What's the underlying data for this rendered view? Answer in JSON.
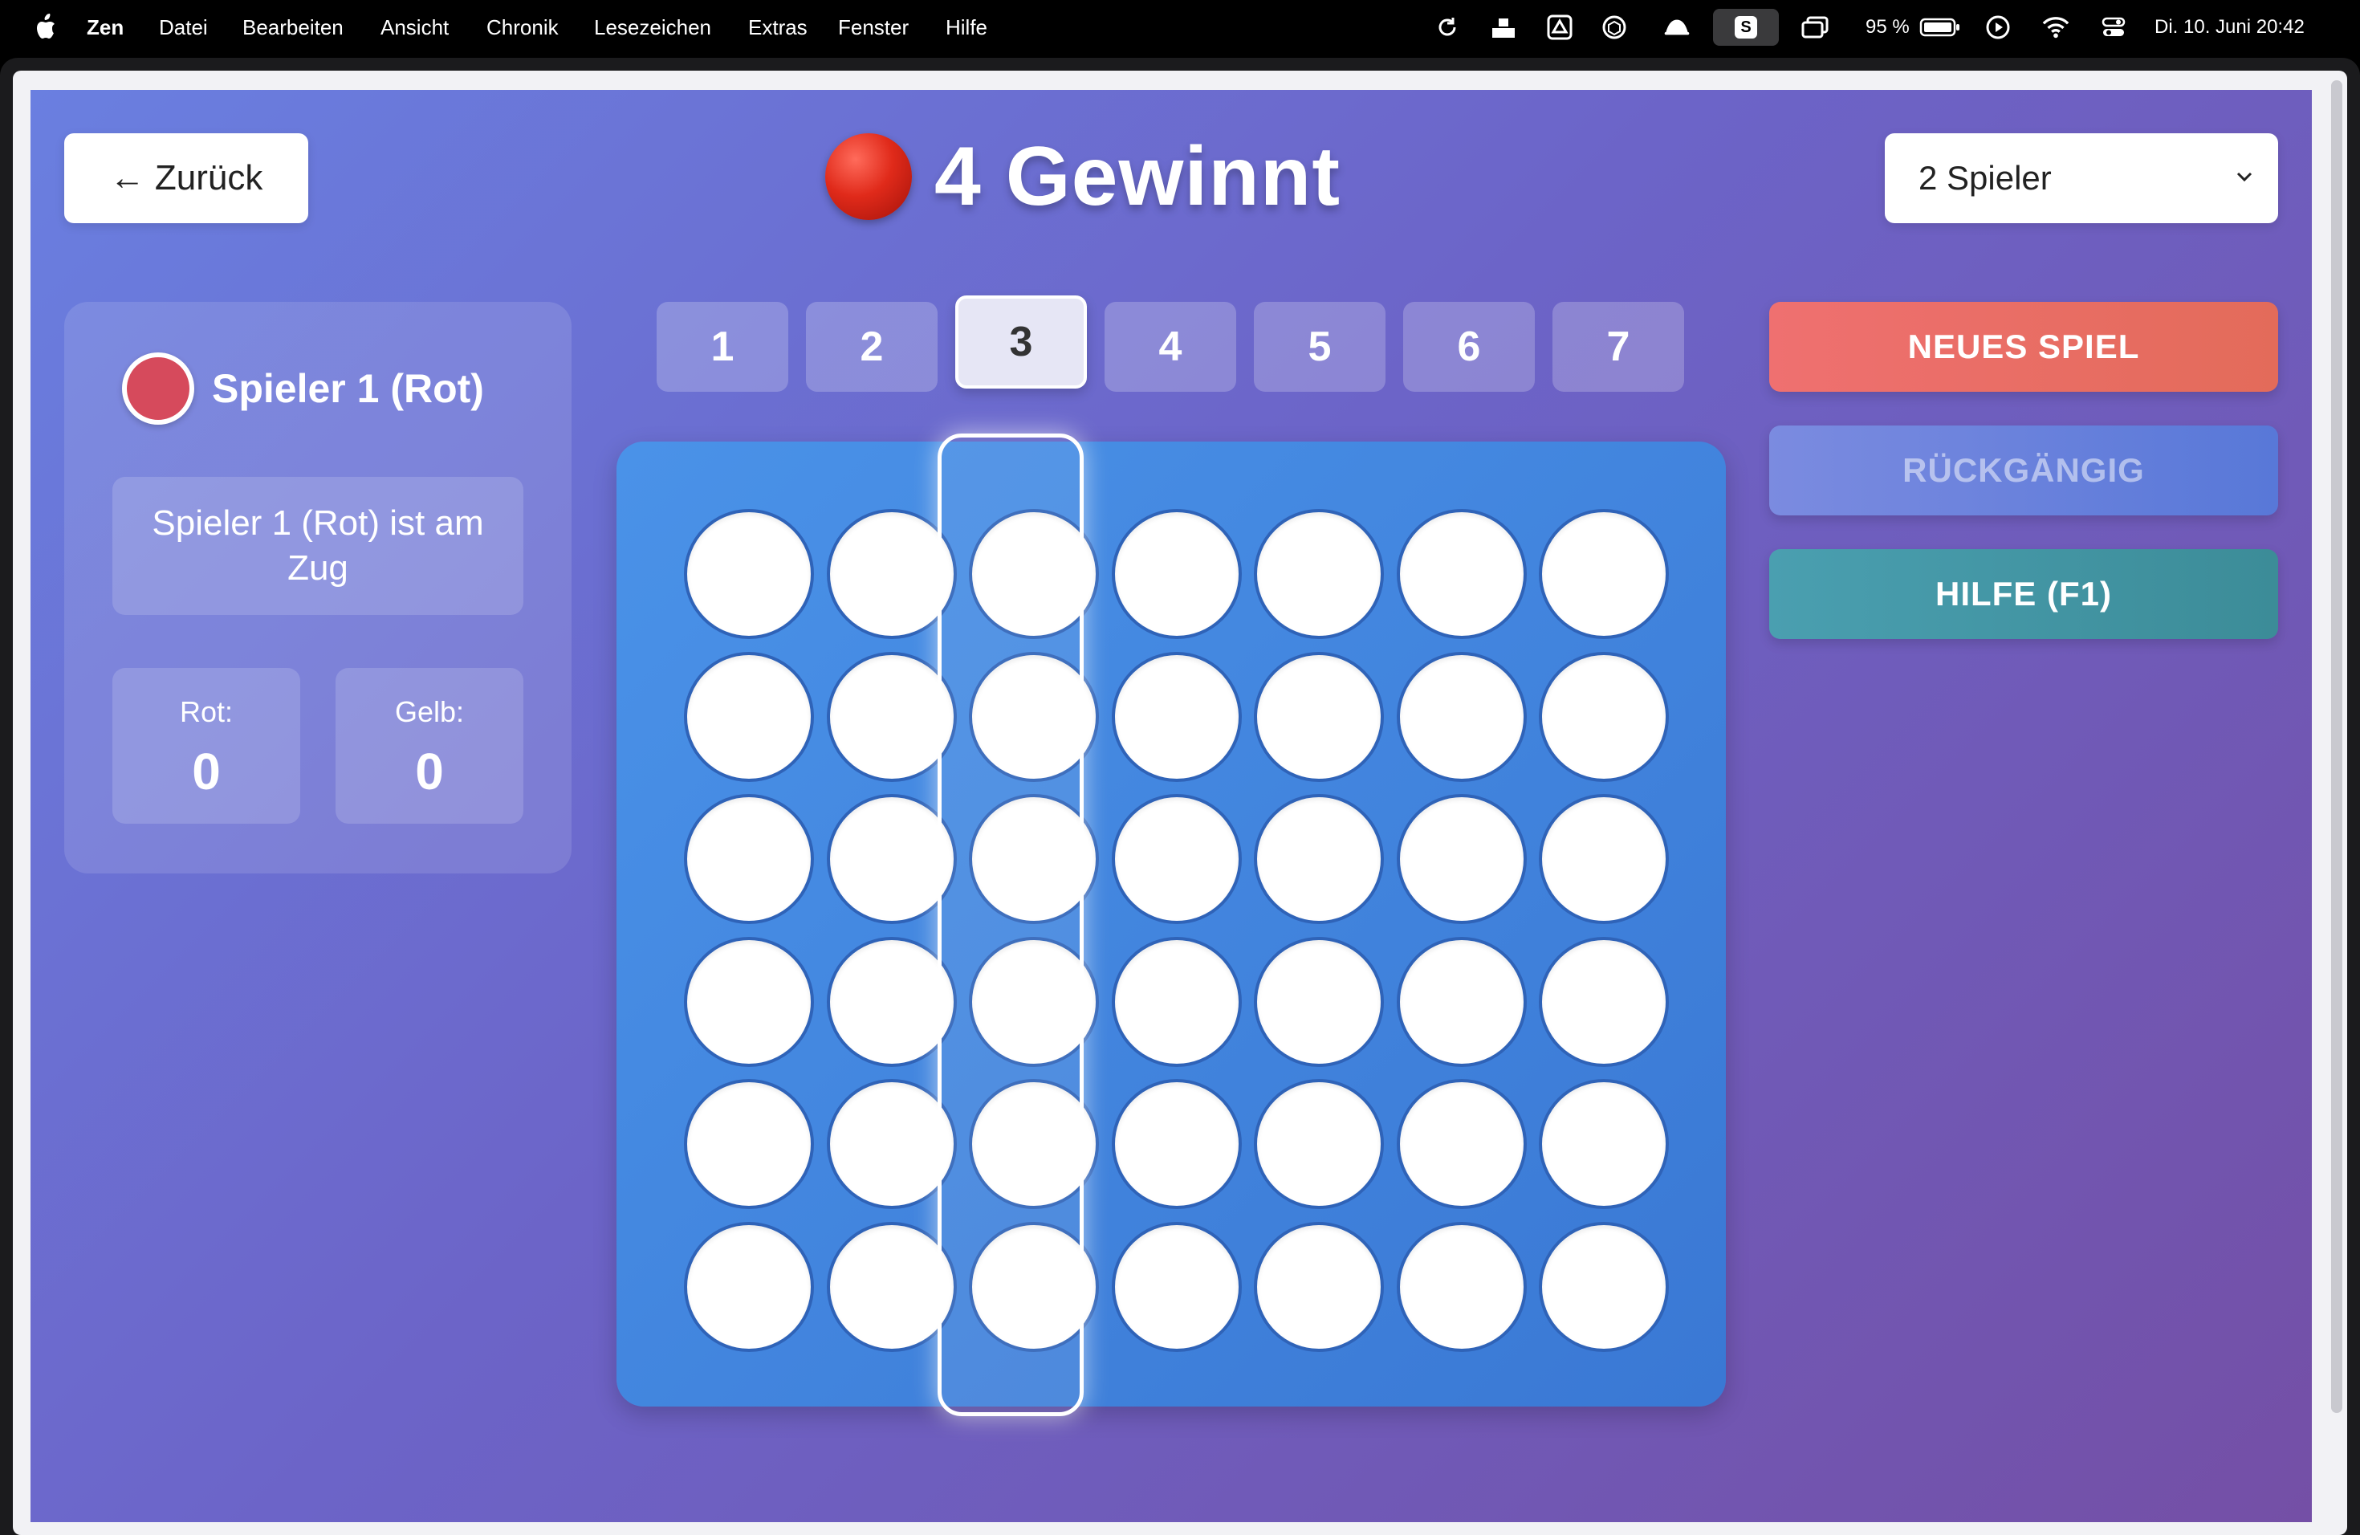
{
  "menubar": {
    "app_name": "Zen",
    "menus": [
      "Datei",
      "Bearbeiten",
      "Ansicht",
      "Chronik",
      "Lesezeichen",
      "Extras",
      "Fenster",
      "Hilfe"
    ],
    "battery": "95 %",
    "datetime": "Di. 10. Juni  20:42",
    "s_badge": "S"
  },
  "header": {
    "back_label": "← Zurück",
    "title": "4 Gewinnt",
    "mode_selected": "2 Spieler"
  },
  "player_panel": {
    "current_player": "Spieler 1 (Rot)",
    "turn_text": "Spieler 1 (Rot) ist am Zug",
    "scores": [
      {
        "label": "Rot:",
        "value": "0"
      },
      {
        "label": "Gelb:",
        "value": "0"
      }
    ]
  },
  "columns": [
    "1",
    "2",
    "3",
    "4",
    "5",
    "6",
    "7"
  ],
  "selected_column": "3",
  "board": {
    "rows": 6,
    "cols": 7,
    "cells": [
      [
        "",
        "",
        "",
        "",
        "",
        "",
        ""
      ],
      [
        "",
        "",
        "",
        "",
        "",
        "",
        ""
      ],
      [
        "",
        "",
        "",
        "",
        "",
        "",
        ""
      ],
      [
        "",
        "",
        "",
        "",
        "",
        "",
        ""
      ],
      [
        "",
        "",
        "",
        "",
        "",
        "",
        ""
      ],
      [
        "",
        "",
        "",
        "",
        "",
        "",
        ""
      ]
    ]
  },
  "actions": {
    "new_game": "NEUES SPIEL",
    "undo": "RÜCKGÄNGIG",
    "help": "HILFE (F1)"
  },
  "colors": {
    "red_player": "#d64a5c",
    "board_blue": "#3f82dc",
    "new_game": "#ea6e66",
    "help": "#4596a4"
  }
}
